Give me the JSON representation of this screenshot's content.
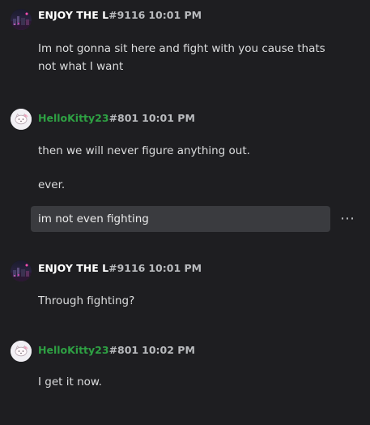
{
  "messages": [
    {
      "username": "ENJOY THE L",
      "discriminator": "#9116",
      "time": "10:01 PM",
      "text": "Im not gonna sit here and fight with you cause thats not what I want"
    },
    {
      "username": "HelloKitty23",
      "discriminator": "#801",
      "time": "10:01 PM",
      "lines": [
        "then we will never figure anything out.",
        "ever.",
        "im not even fighting"
      ]
    },
    {
      "username": "ENJOY THE L",
      "discriminator": "#9116",
      "time": "10:01 PM",
      "text": "Through fighting?"
    },
    {
      "username": "HelloKitty23",
      "discriminator": "#801",
      "time": "10:02 PM",
      "text": "I get it now."
    }
  ],
  "actions": {
    "more_label": "⋯"
  },
  "colors": {
    "background": "#1e1e21",
    "username_white": "#ffffff",
    "username_green": "#2ea043",
    "muted": "#b9bbbe",
    "text": "#dcddde",
    "hover_row": "#3a3b3f"
  }
}
